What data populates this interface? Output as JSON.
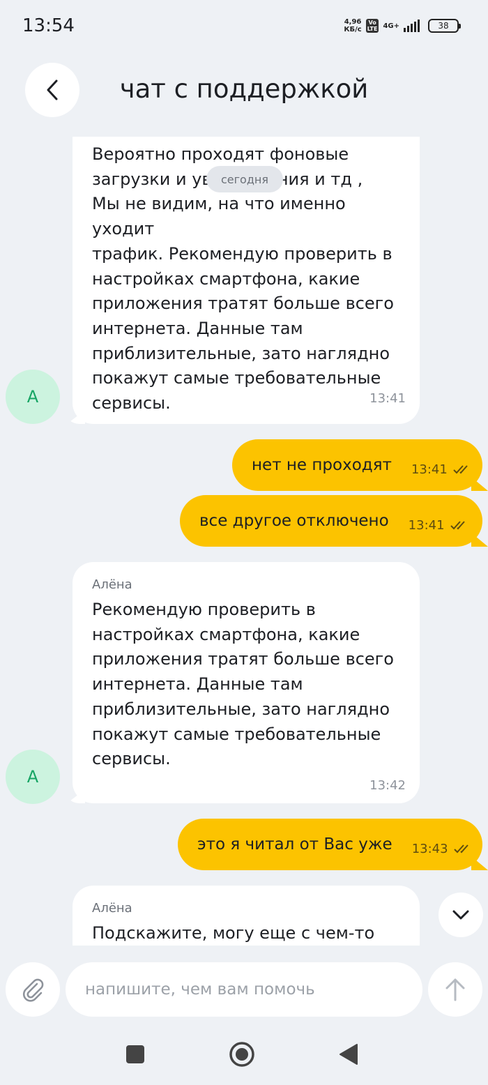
{
  "status_bar": {
    "time": "13:54",
    "net_speed_value": "4,96",
    "net_speed_unit": "КБ/с",
    "volte_top": "Vo",
    "volte_bottom": "LTE",
    "network": "4G+",
    "battery": "38"
  },
  "header": {
    "title": "чат с поддержкой",
    "back_icon": "chevron-left-icon"
  },
  "chat": {
    "date_chip": "сегодня",
    "messages": [
      {
        "direction": "incoming",
        "sender": "",
        "avatar": "А",
        "lines": [
          "Вероятно проходят фоновые",
          "загрузки и уведомления и тд ,",
          "Мы не видим, на что именно уходит",
          "трафик. Рекомендую проверить в",
          "настройках смартфона, какие",
          "приложения тратят больше всего",
          "интернета. Данные там",
          "приблизительные, зато наглядно",
          "покажут самые требовательные",
          "сервисы."
        ],
        "time": "13:41"
      },
      {
        "direction": "outgoing",
        "text": "нет не проходят",
        "time": "13:41",
        "status_icon": "double-check-icon"
      },
      {
        "direction": "outgoing",
        "text": "все другое отключено",
        "time": "13:41",
        "status_icon": "double-check-icon"
      },
      {
        "direction": "incoming",
        "sender": "Алёна",
        "avatar": "А",
        "lines": [
          "Рекомендую проверить в",
          "настройках смартфона, какие",
          "приложения тратят больше всего",
          "интернета. Данные там",
          "приблизительные, зато наглядно",
          "покажут самые требовательные",
          "сервисы."
        ],
        "time": "13:42"
      },
      {
        "direction": "outgoing",
        "text": "это я читал от Вас уже",
        "time": "13:43",
        "status_icon": "double-check-icon"
      },
      {
        "direction": "incoming",
        "sender": "Алёна",
        "lines": [
          "Подскажите, могу еще с чем-то Вам"
        ]
      }
    ]
  },
  "composer": {
    "placeholder": "напишите, чем вам помочь",
    "attach_icon": "paperclip-icon",
    "send_icon": "arrow-up-icon",
    "scroll_icon": "chevron-down-icon"
  },
  "nav": {
    "recents_icon": "square-icon",
    "home_icon": "circle-icon",
    "back_icon": "triangle-back-icon"
  },
  "colors": {
    "background": "#eef1f5",
    "outgoing_bubble": "#fcc300",
    "incoming_bubble": "#ffffff",
    "avatar_bg": "#ccf3df",
    "avatar_text": "#17a564"
  }
}
